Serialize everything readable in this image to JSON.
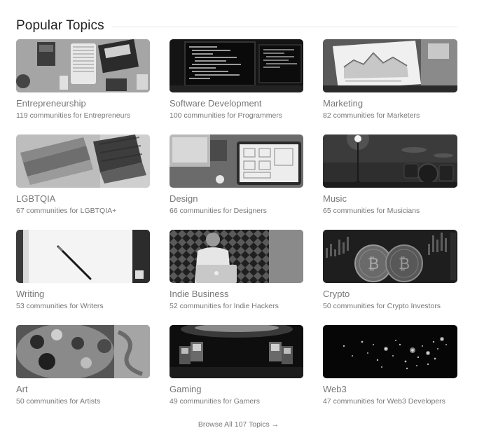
{
  "section": {
    "title": "Popular Topics"
  },
  "topics": [
    {
      "title": "Entrepreneurship",
      "subtitle": "119 communities for Entrepreneurs",
      "image": "desk-flatlay"
    },
    {
      "title": "Software Development",
      "subtitle": "100 communities for Programmers",
      "image": "code-monitors"
    },
    {
      "title": "Marketing",
      "subtitle": "82 communities for Marketers",
      "image": "analytics-laptop"
    },
    {
      "title": "LGBTQIA",
      "subtitle": "67 communities for LGBTQIA+",
      "image": "pride-flags"
    },
    {
      "title": "Design",
      "subtitle": "66 communities for Designers",
      "image": "wireframe-tablet"
    },
    {
      "title": "Music",
      "subtitle": "65 communities for Musicians",
      "image": "studio-drums"
    },
    {
      "title": "Writing",
      "subtitle": "53 communities for Writers",
      "image": "notebook-pen"
    },
    {
      "title": "Indie Business",
      "subtitle": "52 communities for Indie Hackers",
      "image": "person-laptop"
    },
    {
      "title": "Crypto",
      "subtitle": "50 communities for Crypto Investors",
      "image": "bitcoin-chart"
    },
    {
      "title": "Art",
      "subtitle": "50 communities for Artists",
      "image": "paint-palette"
    },
    {
      "title": "Gaming",
      "subtitle": "49 communities for Gamers",
      "image": "arcade-room"
    },
    {
      "title": "Web3",
      "subtitle": "47 communities for Web3 Developers",
      "image": "night-map-lights"
    }
  ],
  "browse": {
    "label": "Browse All 107 Topics →"
  }
}
